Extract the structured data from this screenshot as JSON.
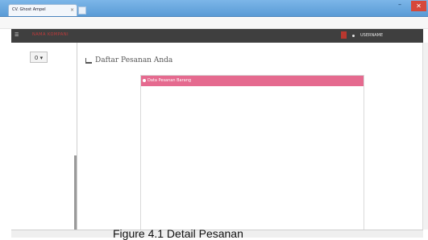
{
  "browser": {
    "tab_title": "CV. Ghost Ampel",
    "tab_close": "×",
    "minimize": "–",
    "close": "✕"
  },
  "app": {
    "brand": "NAMA KOMPANI",
    "user_label": "USERNAME",
    "colors": {
      "navbar": "#3f3f3f",
      "accent": "#e56a8f",
      "brand": "#c43b3b"
    }
  },
  "sidebar": {
    "badge": "0 ▾"
  },
  "main": {
    "heading": "Daftar Pesanan Anda",
    "panel_title": "Data Pesanan Barang"
  },
  "caption": "Figure 4.1 Detail Pesanan"
}
